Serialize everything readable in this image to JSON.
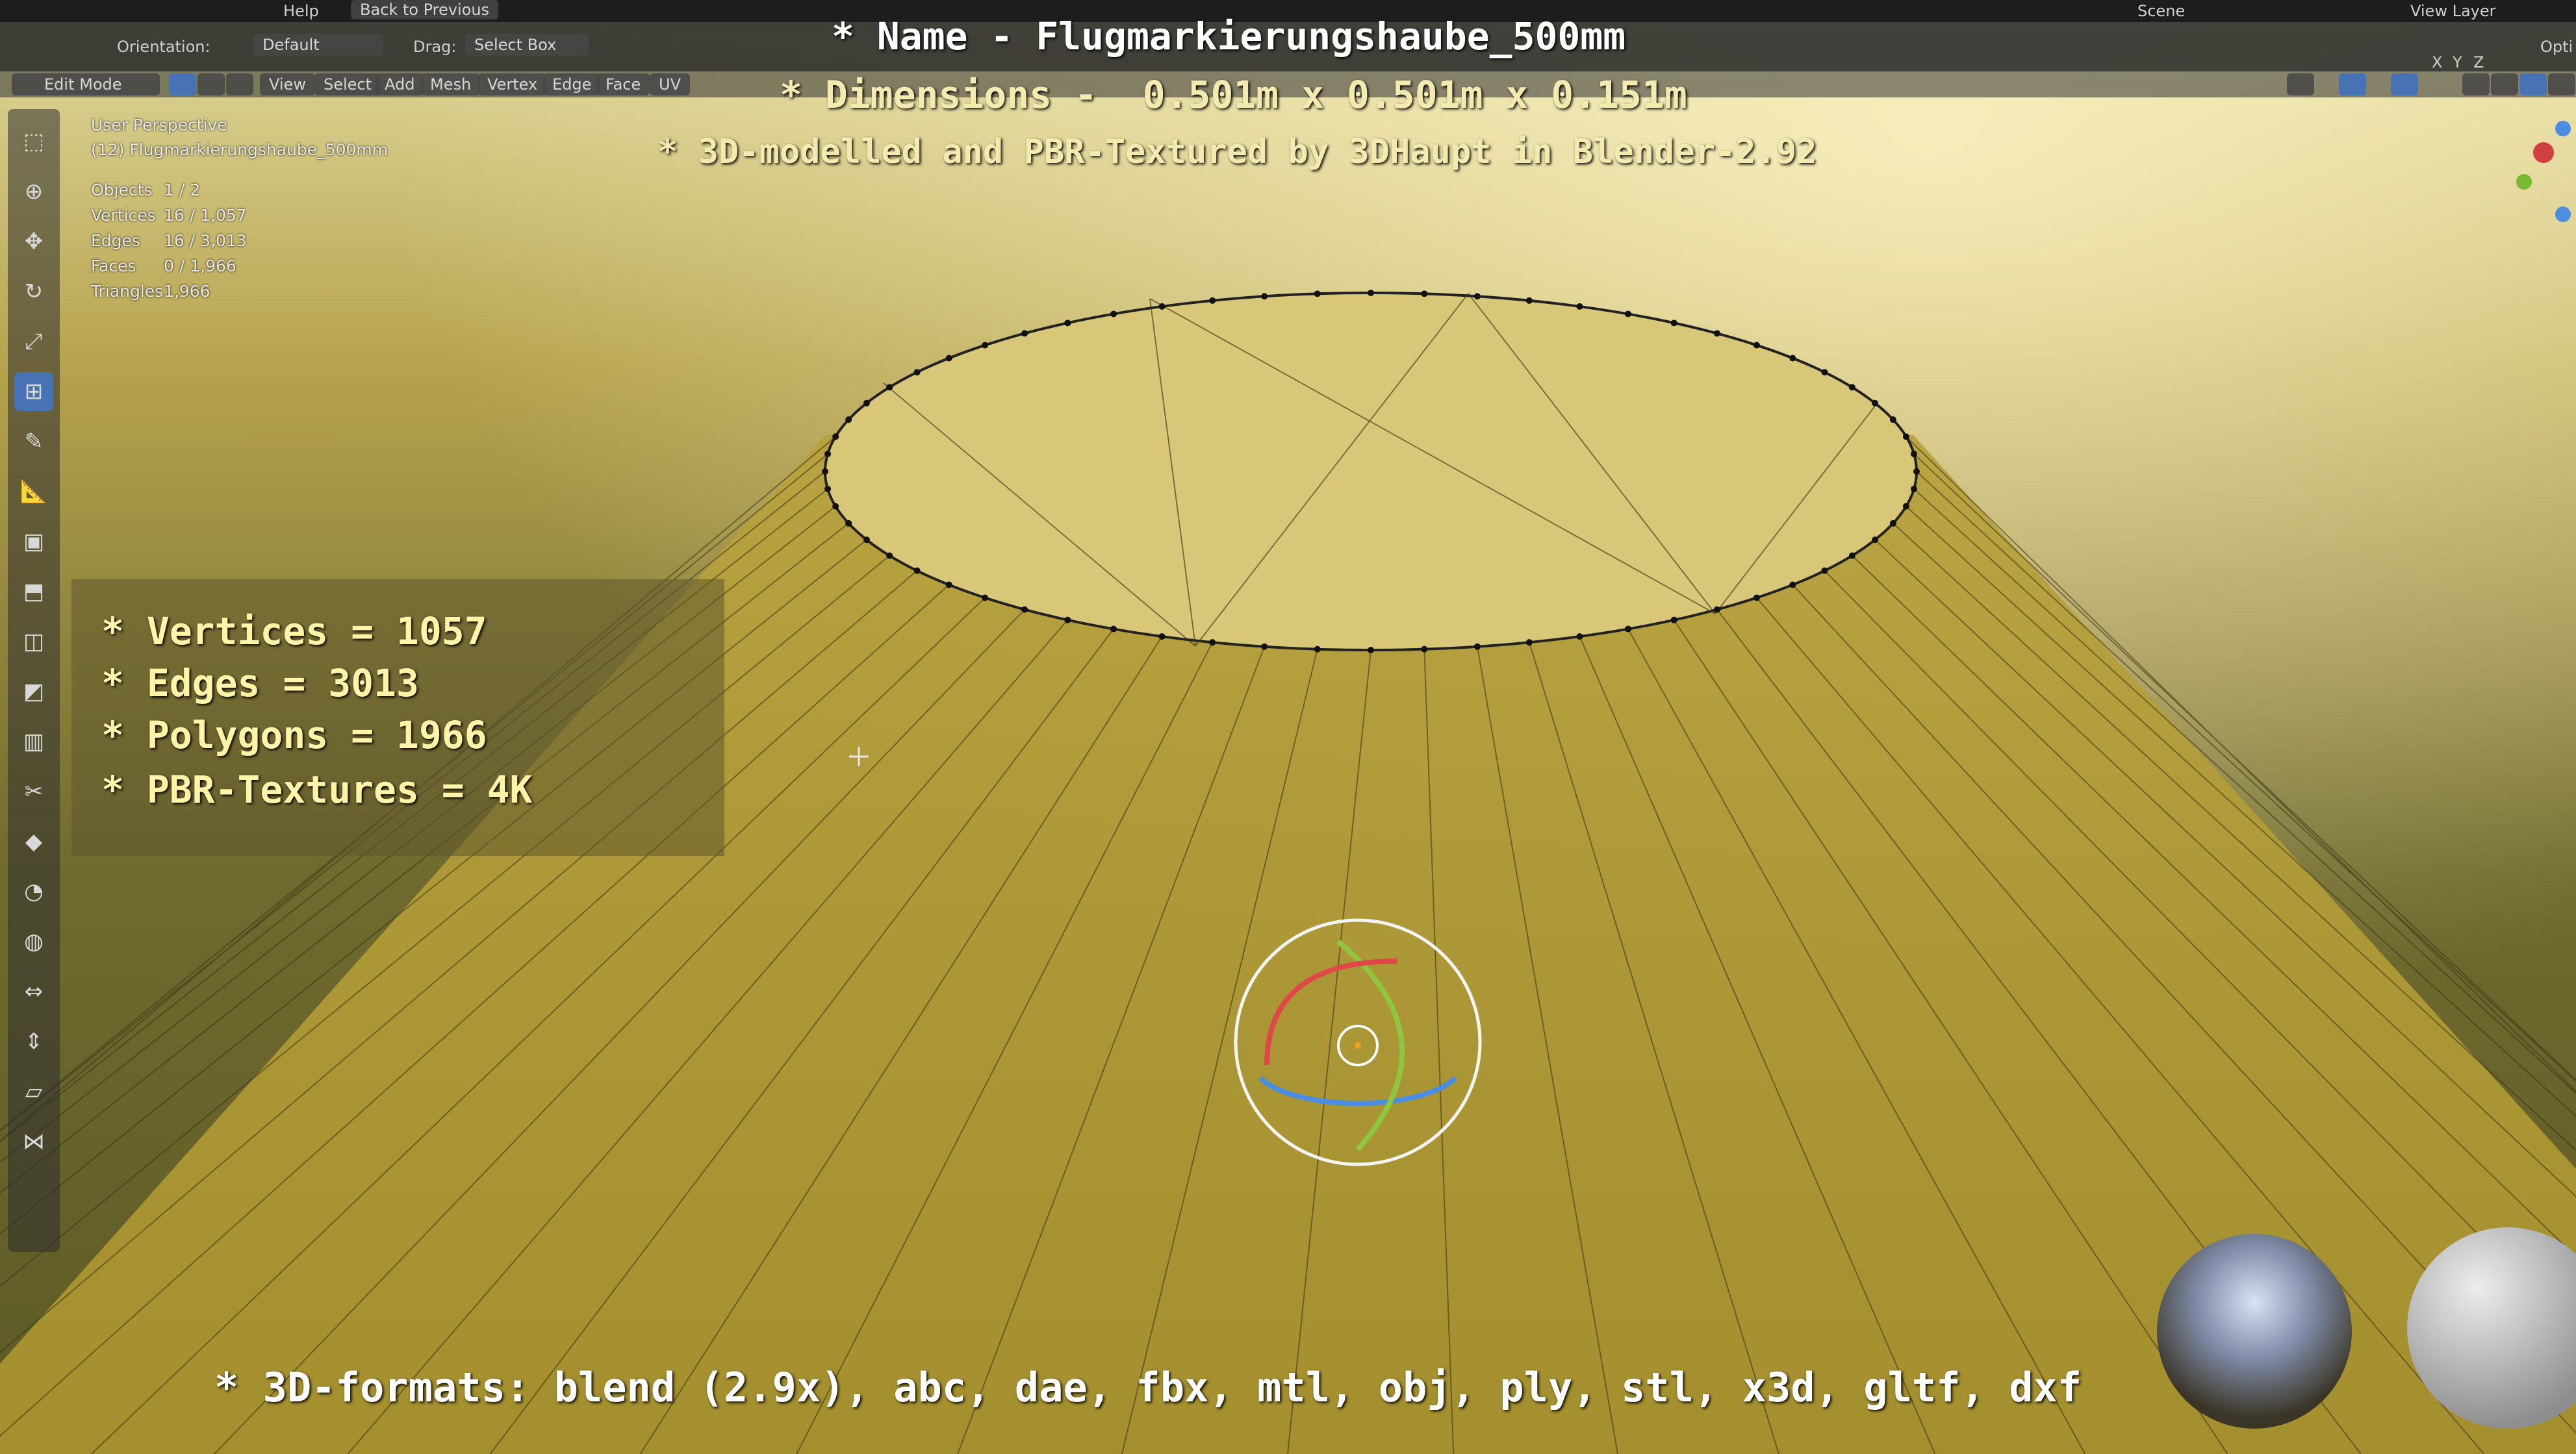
{
  "topbar": {
    "menus": [
      "Help"
    ],
    "back_button": "Back to Previous",
    "scene": "Scene",
    "view_layer": "View Layer"
  },
  "header": {
    "orientation_label": "Orientation:",
    "orientation_value": "Default",
    "drag_label": "Drag:",
    "drag_value": "Select Box",
    "options": "Opti"
  },
  "viewport_header": {
    "mode": "Edit Mode",
    "menus": [
      "View",
      "Select",
      "Add",
      "Mesh",
      "Vertex",
      "Edge",
      "Face",
      "UV"
    ],
    "axis": [
      "X",
      "Y",
      "Z"
    ]
  },
  "overlay_info": {
    "view_name": "User Perspective",
    "object_name": "(12) Flugmarkierungshaube_500mm",
    "stats": [
      {
        "label": "Objects",
        "value": "1 / 2"
      },
      {
        "label": "Vertices",
        "value": "16 / 1,057"
      },
      {
        "label": "Edges",
        "value": "16 / 3,013"
      },
      {
        "label": "Faces",
        "value": "0 / 1,966"
      },
      {
        "label": "Triangles",
        "value": "1,966"
      }
    ]
  },
  "title_overlay": {
    "name": "* Name - Flugmarkierungshaube_500mm",
    "dimensions": "* Dimensions -  0.501m x 0.501m x 0.151m",
    "credit": "* 3D-modelled and PBR-Textured by 3DHaupt in Blender-2.92"
  },
  "info_box": {
    "lines": [
      "* Vertices = 1057",
      "* Edges = 3013",
      "* Polygons = 1966",
      "* PBR-Textures = 4K"
    ]
  },
  "formats_line": "* 3D-formats: blend (2.9x), abc, dae, fbx, mtl, obj, ply, stl, x3d, gltf, dxf",
  "toolbar_tools": [
    "select-box-icon",
    "cursor-icon",
    "move-icon",
    "rotate-icon",
    "scale-icon",
    "transform-icon",
    "annotate-icon",
    "measure-icon",
    "add-cube-icon",
    "extrude-icon",
    "inset-icon",
    "bevel-icon",
    "loop-cut-icon",
    "knife-icon",
    "poly-build-icon",
    "spin-icon",
    "smooth-icon",
    "edge-slide-icon",
    "shrink-fatten-icon",
    "shear-icon",
    "rip-icon"
  ],
  "colors": {
    "accent": "#4772b3",
    "overlay_text": "#fff4a8",
    "mesh_fill": "#c8b24a"
  }
}
